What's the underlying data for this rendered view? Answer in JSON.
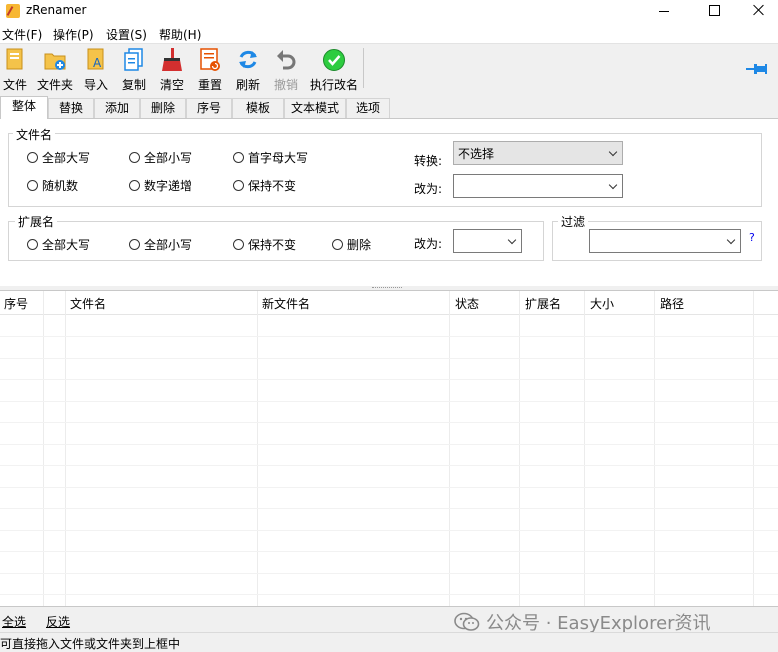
{
  "window": {
    "title": "zRenamer"
  },
  "menu": [
    "文件(F)",
    "操作(P)",
    "设置(S)",
    "帮助(H)"
  ],
  "toolbar": {
    "file": "文件",
    "folder": "文件夹",
    "import": "导入",
    "copy": "复制",
    "clear": "清空",
    "reset": "重置",
    "refresh": "刷新",
    "undo": "撤销",
    "execute": "执行改名"
  },
  "tabs": [
    "整体",
    "替换",
    "添加",
    "删除",
    "序号",
    "模板",
    "文本模式",
    "选项"
  ],
  "filename_group": {
    "title": "文件名",
    "options": [
      "全部大写",
      "全部小写",
      "首字母大写",
      "随机数",
      "数字递增",
      "保持不变"
    ],
    "convert_label": "转换:",
    "convert_value": "不选择",
    "change_label": "改为:"
  },
  "ext_group": {
    "title": "扩展名",
    "options": [
      "全部大写",
      "全部小写",
      "保持不变",
      "删除"
    ],
    "change_label": "改为:"
  },
  "filter_group": {
    "title": "过滤",
    "help": "?"
  },
  "grid": {
    "columns": [
      "序号",
      "文件名",
      "新文件名",
      "状态",
      "扩展名",
      "大小",
      "路径"
    ]
  },
  "bottom": {
    "select_all": "全选",
    "invert": "反选"
  },
  "watermark": "公众号 · EasyExplorer资讯",
  "status": "可直接拖入文件或文件夹到上框中",
  "colors": {
    "accent_blue": "#1e88e5",
    "ok_green": "#2ecc40",
    "red": "#d32f2f"
  }
}
